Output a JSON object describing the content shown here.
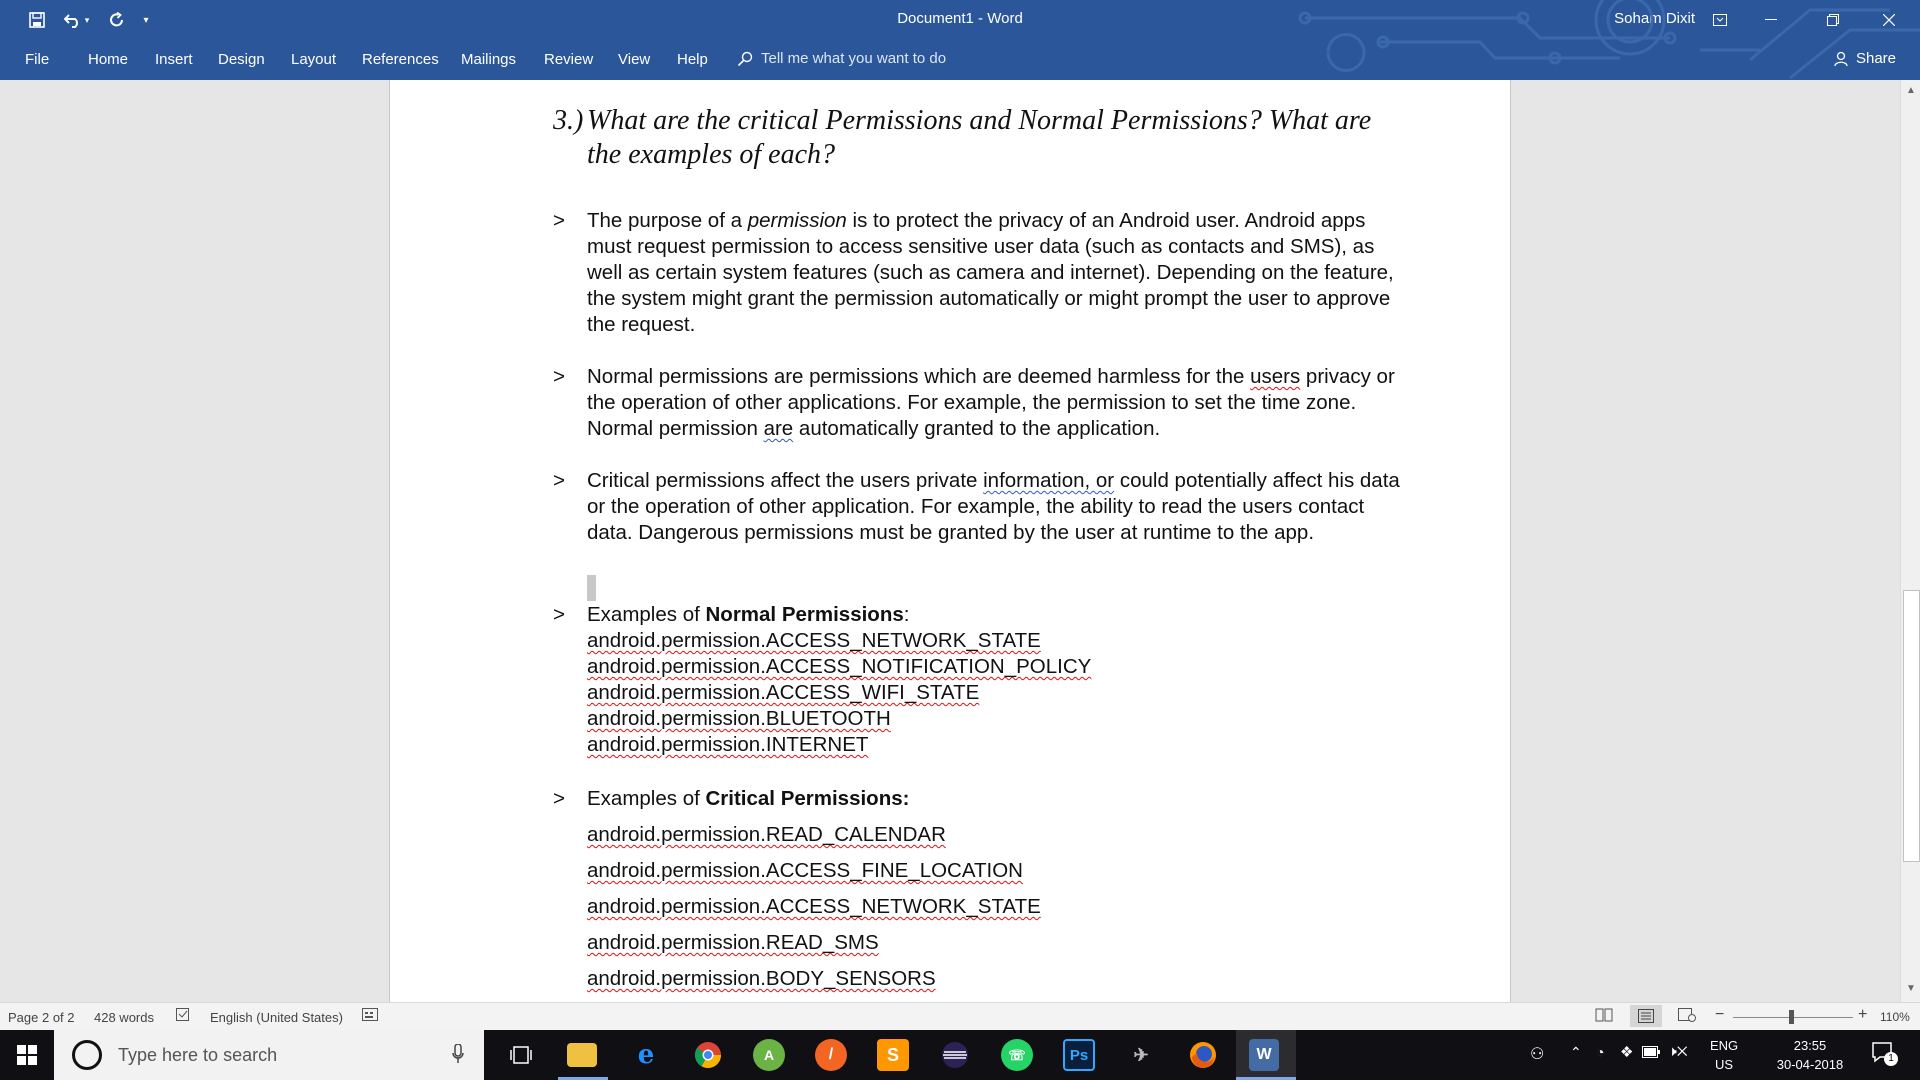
{
  "titlebar": {
    "doc_title": "Document1  -  Word",
    "user": "Soham Dixit",
    "save_icon": "save-icon",
    "undo_icon": "undo-icon",
    "redo_icon": "redo-icon"
  },
  "ribbon": {
    "tabs": [
      "File",
      "Home",
      "Insert",
      "Design",
      "Layout",
      "References",
      "Mailings",
      "Review",
      "View",
      "Help"
    ],
    "tell_me": "Tell me what you want to do",
    "share": "Share"
  },
  "document": {
    "heading_num": "3.)",
    "heading_text": "What are the critical Permissions and Normal Permissions? What are the examples of each?",
    "bullet_marker": ">",
    "para1_a": "The purpose of a ",
    "para1_em": "permission",
    "para1_b": " is to protect the privacy of an Android user. Android apps must request permission to access sensitive user data (such as contacts and SMS), as well as certain system features (such as camera and internet). Depending on the feature, the system might grant the permission automatically or might prompt the user to approve the request.",
    "para2_a": "Normal permissions are permissions which are deemed harmless for the ",
    "para2_users": "users",
    "para2_b": " privacy or the operation of other applications. For example, the permission to set the time zone. Normal permission ",
    "para2_are": "are",
    "para2_c": " automatically granted to the application.",
    "para3_a": "Critical permissions affect the users private ",
    "para3_info": "information, or",
    "para3_b": " could potentially affect his data or the operation of other application. For example, the ability to read the users contact data. Dangerous permissions must be granted by the user at runtime to the app.",
    "normal_prefix": "Examples of ",
    "normal_bold": "Normal Permissions",
    "normal_suffix": ":",
    "normal_list": [
      "android.permission.ACCESS_NETWORK_STATE",
      "android.permission.ACCESS_NOTIFICATION_POLICY",
      "android.permission.ACCESS_WIFI_STATE",
      "android.permission.BLUETOOTH",
      "android.permission.INTERNET"
    ],
    "critical_prefix": "Examples of ",
    "critical_bold": "Critical Permissions:",
    "critical_list": [
      "android.permission.READ_CALENDAR",
      "android.permission.ACCESS_FINE_LOCATION",
      "android.permission.ACCESS_NETWORK_STATE",
      "android.permission.READ_SMS",
      "android.permission.BODY_SENSORS"
    ]
  },
  "statusbar": {
    "page": "Page 2 of 2",
    "words": "428 words",
    "language": "English (United States)",
    "zoom": "110%",
    "zoom_level": 1.1
  },
  "taskbar": {
    "search_placeholder": "Type here to search",
    "lang_top": "ENG",
    "lang_bottom": "US",
    "time": "23:55",
    "date": "30-04-2018",
    "notification_count": "1"
  },
  "colors": {
    "word_blue": "#2b579a",
    "spell_red": "#d11",
    "grammar_blue": "#2e5cb8"
  }
}
